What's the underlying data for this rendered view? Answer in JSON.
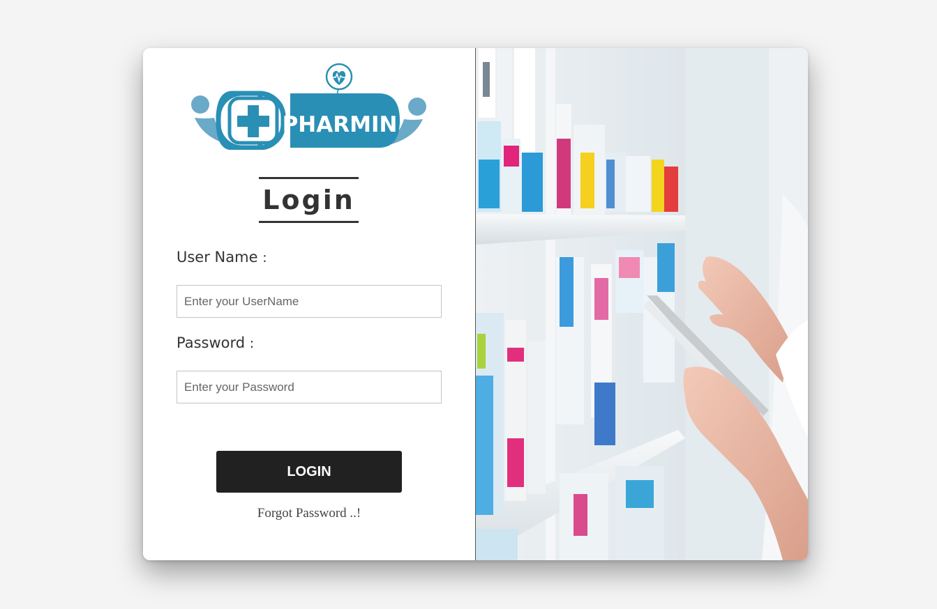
{
  "logo": {
    "brand_text": "PHARMIN",
    "accent_color": "#2a8fb5",
    "secondary_color": "#6aa9c8",
    "icon": "heart-pulse-icon"
  },
  "form": {
    "heading": "Login",
    "username_label": "User Name",
    "username_colon": ":",
    "username_placeholder": "Enter your UserName",
    "username_value": "",
    "password_label": "Password",
    "password_colon": ":",
    "password_placeholder": "Enter your Password",
    "password_value": "",
    "login_button_label": "LOGIN",
    "forgot_password_text": "Forgot Password ..!"
  },
  "colors": {
    "page_background": "#f4f4f4",
    "button_background": "#212121",
    "text": "#333333"
  },
  "photo": {
    "subject": "pharmacy-shelves-with-tablet-photo"
  }
}
